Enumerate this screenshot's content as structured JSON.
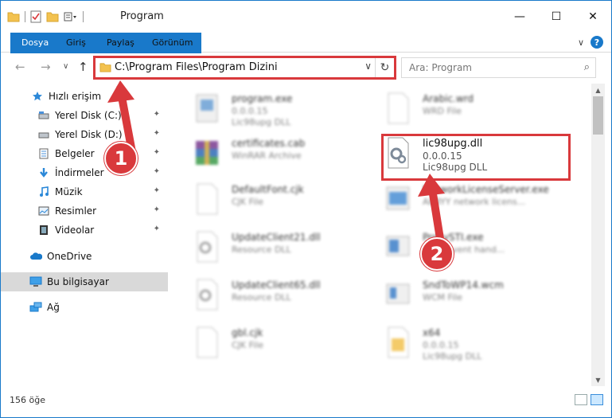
{
  "window": {
    "title": "Program",
    "minimize": "—",
    "maximize": "☐",
    "close": "✕"
  },
  "ribbon": {
    "tabs": [
      "Dosya",
      "Giriş",
      "Paylaş",
      "Görünüm"
    ],
    "expand": "∨",
    "help": "?"
  },
  "nav": {
    "back": "←",
    "forward": "→",
    "recent": "∨",
    "up": "↑",
    "address": "C:\\Program Files\\Program Dizini",
    "address_chevron": "∨",
    "refresh": "↻",
    "search_placeholder": "Ara: Program",
    "search_icon": "⌕"
  },
  "sidebar": {
    "items": [
      {
        "label": "Hızlı erişim",
        "icon": "star-icon"
      },
      {
        "label": "Yerel Disk (C:)",
        "icon": "drive-icon"
      },
      {
        "label": "Yerel Disk (D:)",
        "icon": "drive-icon"
      },
      {
        "label": "Belgeler",
        "icon": "documents-icon"
      },
      {
        "label": "İndirmeler",
        "icon": "download-icon"
      },
      {
        "label": "Müzik",
        "icon": "music-icon"
      },
      {
        "label": "Resimler",
        "icon": "pictures-icon"
      },
      {
        "label": "Videolar",
        "icon": "video-icon"
      },
      {
        "label": "OneDrive",
        "icon": "cloud-icon"
      },
      {
        "label": "Bu bilgisayar",
        "icon": "computer-icon"
      },
      {
        "label": "Ağ",
        "icon": "network-icon"
      }
    ],
    "pin": "📌"
  },
  "files": [
    {
      "name": "program.exe",
      "sub1": "0.0.0.15",
      "sub2": "Lic98upg DLL",
      "icon": "exe-icon"
    },
    {
      "name": "Arabic.wrd",
      "sub1": "WRD File",
      "sub2": "",
      "icon": "document-file-icon"
    },
    {
      "name": "certificates.cab",
      "sub1": "WinRAR Archive",
      "sub2": "",
      "icon": "winrar-icon"
    },
    {
      "name": "lic98upg.dll",
      "sub1": "0.0.0.15",
      "sub2": "Lic98upg DLL",
      "icon": "dll-gear-icon"
    },
    {
      "name": "DefaultFont.cjk",
      "sub1": "CJK File",
      "sub2": "",
      "icon": "document-file-icon"
    },
    {
      "name": "NetworkLicenseServer.exe",
      "sub1": "ABBYY network licens...",
      "sub2": "",
      "icon": "exe-icon"
    },
    {
      "name": "UpdateClient21.dll",
      "sub1": "Resource DLL",
      "sub2": "",
      "icon": "dll-gear-icon"
    },
    {
      "name": "ProxySTI.exe",
      "sub1": "Scan event hand...",
      "sub2": "",
      "icon": "exe-icon"
    },
    {
      "name": "UpdateClient65.dll",
      "sub1": "Resource DLL",
      "sub2": "",
      "icon": "dll-gear-icon"
    },
    {
      "name": "SndToWP14.wcm",
      "sub1": "WCM File",
      "sub2": "",
      "icon": "exe-icon"
    },
    {
      "name": "gbl.cjk",
      "sub1": "CJK File",
      "sub2": "",
      "icon": "document-file-icon"
    },
    {
      "name": "x64",
      "sub1": "0.0.0.15",
      "sub2": "Lic98upg DLL",
      "icon": "folder-file-icon"
    }
  ],
  "status": {
    "count": "156 öğe"
  },
  "annotations": {
    "badge1": "1",
    "badge2": "2"
  },
  "colors": {
    "accent": "#1979ca",
    "highlight": "#d9393c"
  }
}
